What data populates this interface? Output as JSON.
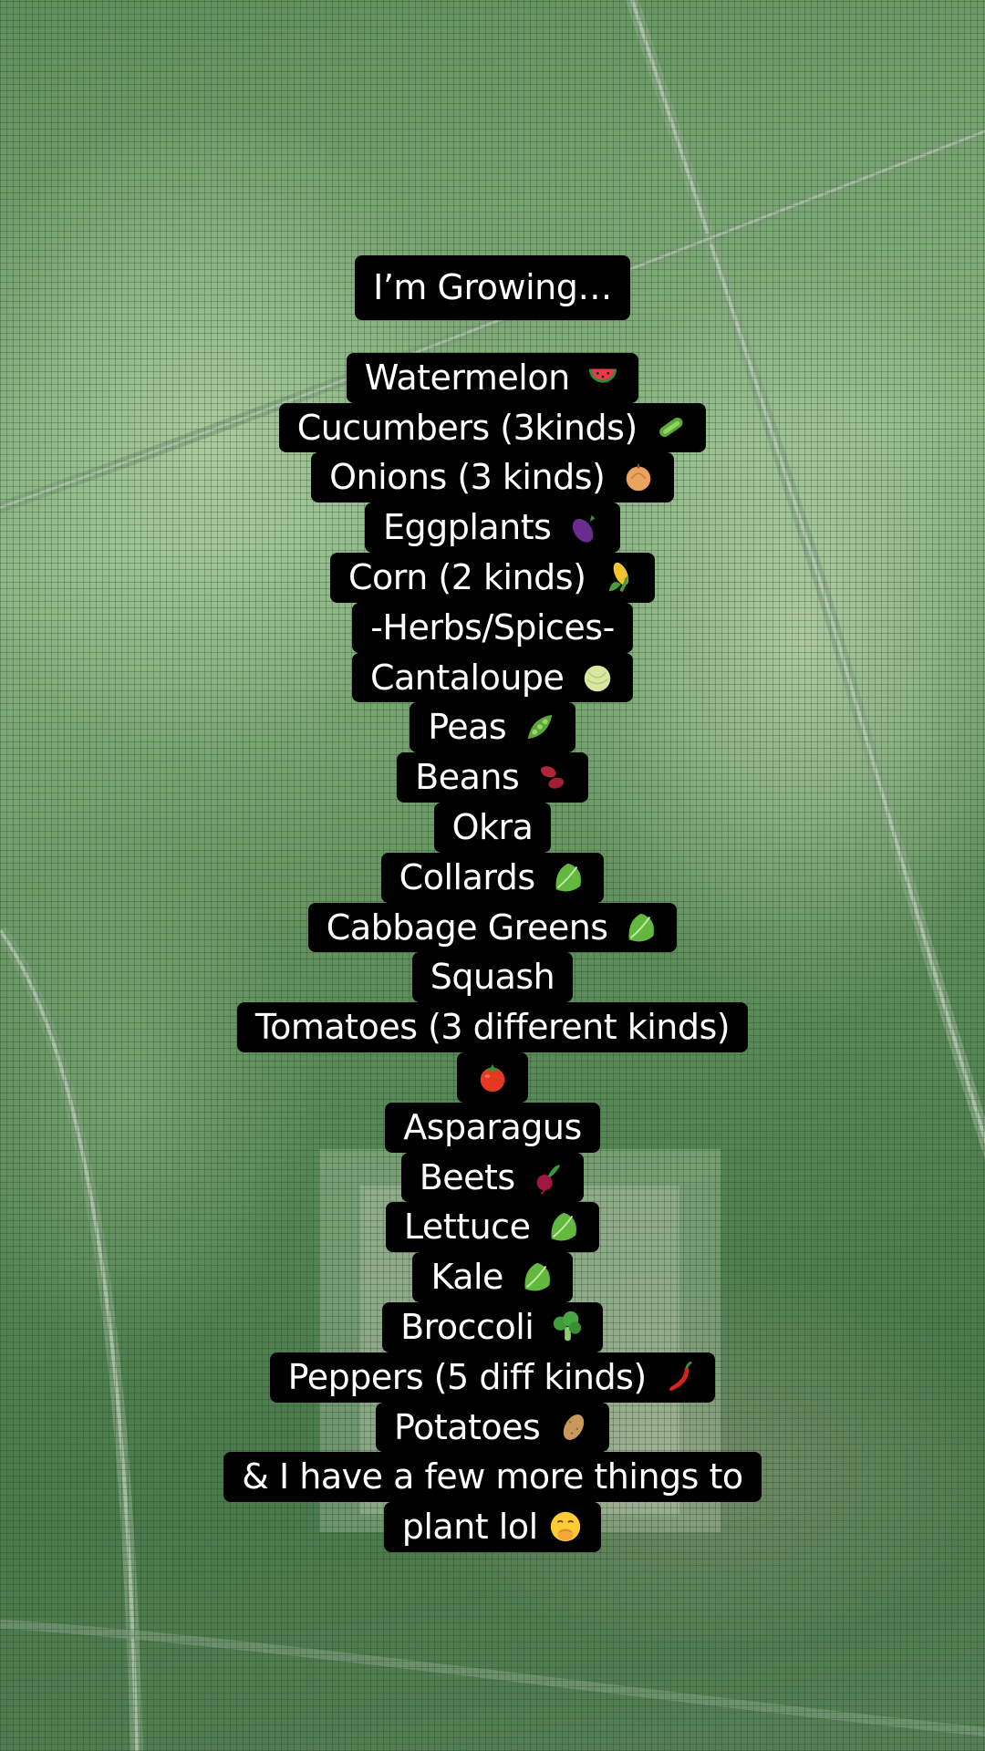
{
  "overlay": {
    "title": "I’m Growing…",
    "lines": [
      {
        "text": "Watermelon",
        "icon": "watermelon-icon"
      },
      {
        "text": "Cucumbers (3kinds)",
        "icon": "cucumber-icon"
      },
      {
        "text": "Onions (3 kinds)",
        "icon": "onion-icon"
      },
      {
        "text": "Eggplants",
        "icon": "eggplant-icon"
      },
      {
        "text": "Corn (2 kinds)",
        "icon": "corn-icon"
      },
      {
        "text": "-Herbs/Spices-",
        "icon": ""
      },
      {
        "text": "Cantaloupe",
        "icon": "melon-icon"
      },
      {
        "text": "Peas",
        "icon": "pea-pod-icon"
      },
      {
        "text": "Beans",
        "icon": "beans-icon"
      },
      {
        "text": "Okra",
        "icon": ""
      },
      {
        "text": "Collards",
        "icon": "leafy-green-icon"
      },
      {
        "text": "Cabbage Greens",
        "icon": "leafy-green-icon"
      },
      {
        "text": "Squash",
        "icon": ""
      },
      {
        "text": "Tomatoes (3 different kinds)",
        "icon": ""
      },
      {
        "text": "",
        "icon": "tomato-icon"
      },
      {
        "text": "Asparagus",
        "icon": ""
      },
      {
        "text": "Beets",
        "icon": "beet-icon"
      },
      {
        "text": "Lettuce",
        "icon": "leafy-green-icon"
      },
      {
        "text": "Kale",
        "icon": "leafy-green-icon"
      },
      {
        "text": "Broccoli",
        "icon": "broccoli-icon"
      },
      {
        "text": "Peppers (5 diff kinds)",
        "icon": "hot-pepper-icon"
      },
      {
        "text": "Potatoes",
        "icon": "potato-icon"
      },
      {
        "text": "& I have a few more things to",
        "icon": ""
      },
      {
        "text": "plant lol",
        "icon": "face-with-hand-over-mouth-icon"
      }
    ]
  }
}
